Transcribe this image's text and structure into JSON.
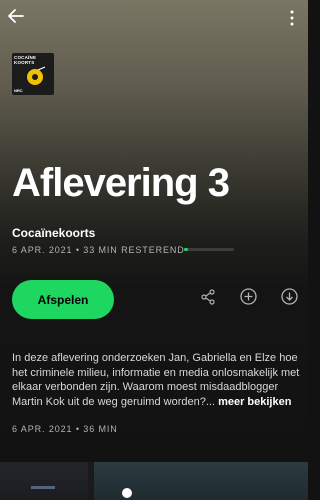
{
  "header": {
    "back_icon": "arrow-left-icon",
    "more_icon": "more-vertical-icon"
  },
  "cover": {
    "title_line1": "COCAÏNE",
    "title_line2": "KOORTS",
    "mark": "NRC"
  },
  "episode": {
    "title": "Aflevering 3",
    "show_name": "Cocaïnekoorts",
    "meta": "6 APR. 2021 • 33 MIN RESTEREND",
    "progress_fraction": 0.08,
    "play_label": "Afspelen",
    "description": "In deze aflevering onderzoeken Jan, Gabriella en Elze hoe het criminele milieu, informatie en media onlosmakelijk met elkaar verbonden zijn. Waarom moest misdaadblogger Martin Kok uit de weg geruimd worden?...",
    "more_label": "meer bekijken",
    "date_duration": "6 APR. 2021 • 36 MIN"
  },
  "actions": {
    "share_icon": "share-icon",
    "add_icon": "add-circle-icon",
    "download_icon": "download-circle-icon"
  },
  "colors": {
    "accent": "#1ed760",
    "background": "#121212",
    "header_gradient_top": "#7a7664"
  }
}
